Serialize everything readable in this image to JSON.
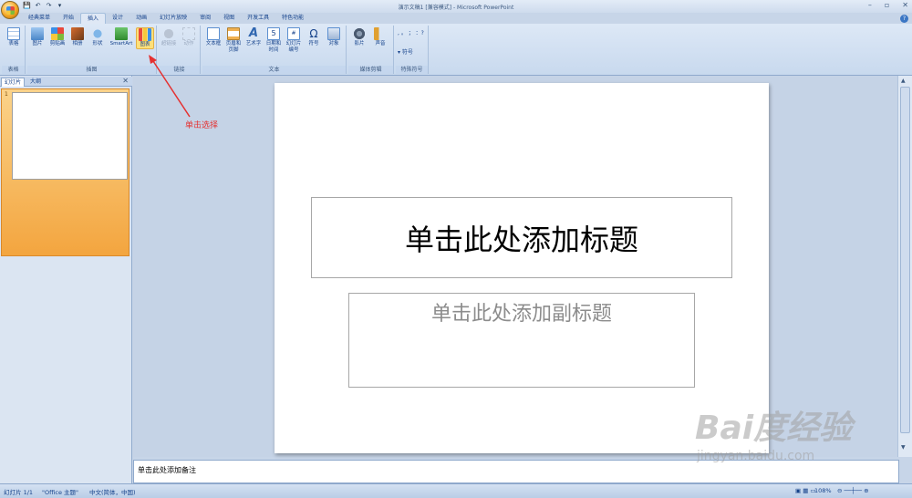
{
  "window": {
    "title": "演示文稿1 [兼容模式] - Microsoft PowerPoint"
  },
  "quick_access": [
    "save-icon",
    "undo-icon",
    "redo-icon",
    "customize-icon"
  ],
  "tabs": [
    "经典菜单",
    "开始",
    "插入",
    "设计",
    "动画",
    "幻灯片放映",
    "审阅",
    "视图",
    "开发工具",
    "特色功能"
  ],
  "active_tab": "插入",
  "ribbon": {
    "groups": {
      "table": "表格",
      "illustrations": "插图",
      "links": "链接",
      "text": "文本",
      "media": "媒体剪辑",
      "special_symbols": "特殊符号"
    },
    "buttons": {
      "table": "表格",
      "picture": "图片",
      "clipart": "剪贴画",
      "album": "相册",
      "shapes": "形状",
      "smartart": "SmartArt",
      "chart": "图表",
      "hyperlink": "超链接",
      "action": "动作",
      "textbox": "文本框",
      "header_footer": "页眉和页脚",
      "wordart": "艺术字",
      "datetime": "日期和时间",
      "slide_number": "幻灯片编号",
      "symbol": "符号",
      "object": "对象",
      "movie": "影片",
      "sound": "声音",
      "symbol2": "符号"
    },
    "symbol_chars": ", 。 ； ：?"
  },
  "left_pane": {
    "tab_slides": "幻灯片",
    "tab_outline": "大纲",
    "slide_number": "1"
  },
  "slide": {
    "title_placeholder": "单击此处添加标题",
    "subtitle_placeholder": "单击此处添加副标题"
  },
  "notes_placeholder": "单击此处添加备注",
  "annotation": "单击选择",
  "status": {
    "slide": "幻灯片 1/1",
    "theme": "\"Office 主题\"",
    "language": "中文(简体，中国)",
    "zoom": "108%"
  },
  "watermark": {
    "logo": "Bai度经验",
    "url": "jingyan.baidu.com"
  },
  "colors": {
    "accent": "#e53030",
    "ribbon": "#dde8f6",
    "highlight": "#fde07a"
  }
}
